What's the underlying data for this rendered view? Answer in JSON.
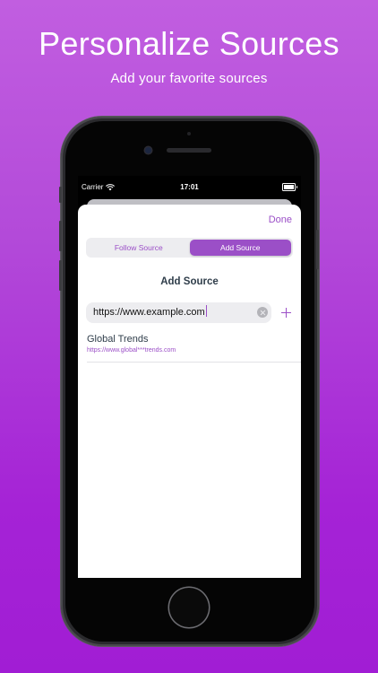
{
  "banner": {
    "title": "Personalize Sources",
    "subtitle": "Add your favorite sources"
  },
  "status_bar": {
    "carrier": "Carrier",
    "time": "17:01"
  },
  "sheet": {
    "done_label": "Done",
    "tabs": [
      {
        "label": "Follow Source",
        "active": false
      },
      {
        "label": "Add Source",
        "active": true
      }
    ],
    "section_title": "Add Source",
    "url_input": {
      "value": "https://www.example.com"
    },
    "results": [
      {
        "name": "Global Trends",
        "url": "https://www.global***trends.com"
      }
    ]
  },
  "colors": {
    "accent": "#9b4fc7",
    "background_top": "#c15ee0",
    "background_bottom": "#a11dd4",
    "title_text": "#2f3d4a"
  },
  "icons": {
    "wifi": "wifi-icon",
    "battery": "battery-icon",
    "clear": "clear-icon",
    "add": "plus-icon"
  }
}
